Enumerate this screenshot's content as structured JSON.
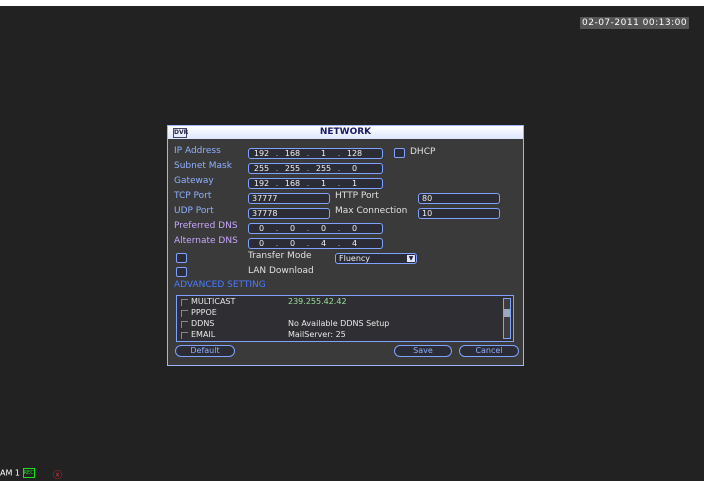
{
  "screen": {
    "timestamp": "02-07-2011 00:13:00",
    "status_prefix": "AM 1",
    "record_indicator": "REC",
    "alarm_indicator": "ⓧ"
  },
  "dialog": {
    "title": "NETWORK",
    "logo": "DVR",
    "fields": {
      "ip_label": "IP Address",
      "ip": [
        "192",
        "168",
        "1",
        "128"
      ],
      "dhcp_label": "DHCP",
      "subnet_label": "Subnet Mask",
      "subnet": [
        "255",
        "255",
        "255",
        "0"
      ],
      "gateway_label": "Gateway",
      "gateway": [
        "192",
        "168",
        "1",
        "1"
      ],
      "tcp_label": "TCP Port",
      "tcp": "37777",
      "http_label": "HTTP Port",
      "http": "80",
      "udp_label": "UDP Port",
      "udp": "37778",
      "maxconn_label": "Max Connection",
      "maxconn": "10",
      "pdns_label": "Preferred DNS",
      "pdns": [
        "0",
        "0",
        "0",
        "0"
      ],
      "adns_label": "Alternate DNS",
      "adns": [
        "0",
        "0",
        "4",
        "4"
      ],
      "transfer_label": "Transfer Mode",
      "transfer_value": "Fluency",
      "lan_label": "LAN Download"
    },
    "advanced_label": "ADVANCED SETTING",
    "advanced_items": [
      {
        "name": "MULTICAST",
        "value": "239.255.42.42"
      },
      {
        "name": "PPPOE",
        "value": ""
      },
      {
        "name": "DDNS",
        "value": "No Available DDNS Setup"
      },
      {
        "name": "EMAIL",
        "value": "MailServer: 25"
      }
    ],
    "buttons": {
      "default": "Default",
      "save": "Save",
      "cancel": "Cancel"
    }
  }
}
